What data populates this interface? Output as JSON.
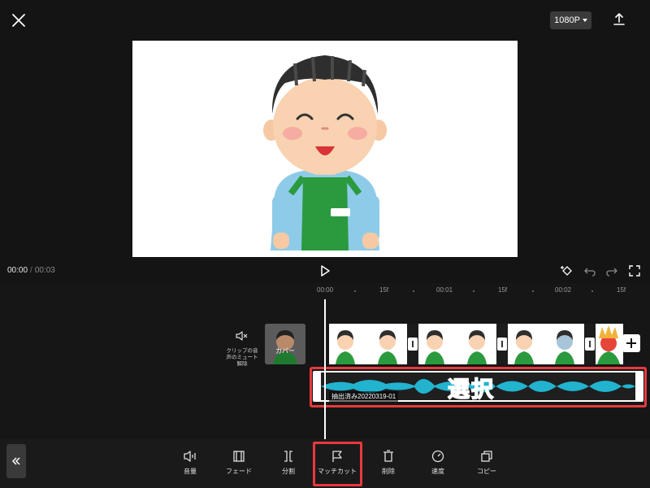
{
  "header": {
    "resolution": "1080P"
  },
  "player": {
    "current_time": "00:00",
    "separator": "/",
    "total_time": "00:03"
  },
  "ruler": {
    "labels": [
      "00:00",
      "15f",
      "00:01",
      "15f",
      "00:02",
      "15f"
    ]
  },
  "track": {
    "mute_label": "クリップの音\n声のミュート\n解除",
    "cover_label": "カバー"
  },
  "audio": {
    "name": "抽出済み20220319-01",
    "annotation": "選択"
  },
  "toolbar": {
    "items": [
      {
        "label": "音量",
        "icon": "volume-icon"
      },
      {
        "label": "フェード",
        "icon": "fade-icon"
      },
      {
        "label": "分割",
        "icon": "split-icon"
      },
      {
        "label": "マッチカット",
        "icon": "flag-icon"
      },
      {
        "label": "削除",
        "icon": "trash-icon"
      },
      {
        "label": "速度",
        "icon": "speed-icon"
      },
      {
        "label": "コピー",
        "icon": "copy-icon"
      }
    ]
  },
  "colors": {
    "highlight": "#e8393e",
    "waveform": "#22b3cf",
    "background": "#121212"
  }
}
